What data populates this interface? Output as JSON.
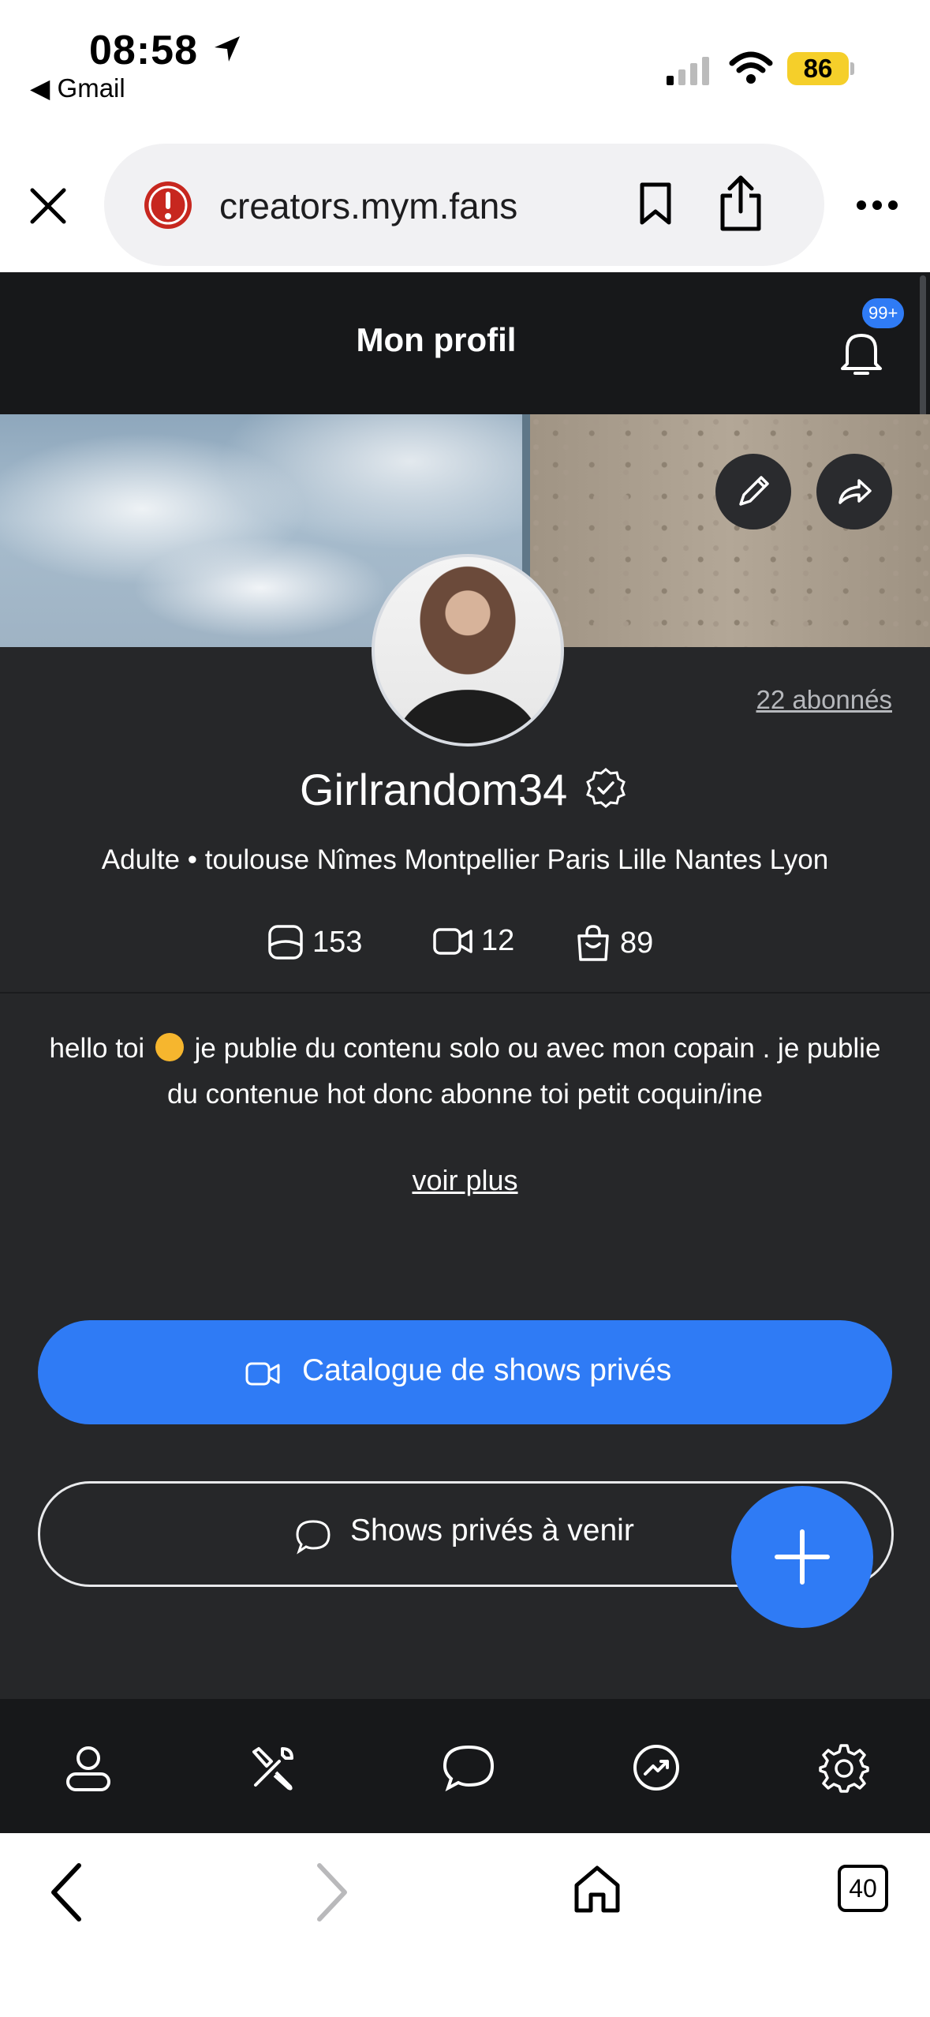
{
  "status_bar": {
    "time": "08:58",
    "back_app": "Gmail",
    "battery": "86"
  },
  "browser": {
    "url": "creators.mym.fans",
    "tab_count": "40"
  },
  "header": {
    "title": "Mon profil",
    "notification_badge": "99+"
  },
  "profile": {
    "subscribers": "22 abonnés",
    "username": "Girlrandom34",
    "tagline": "Adulte • toulouse Nîmes Montpellier Paris Lille Nantes Lyon",
    "stats": {
      "photos": "153",
      "videos": "12",
      "purchases": "89"
    },
    "bio_part1": "hello toi",
    "bio_part2": "je publie du contenu solo ou avec mon copain . je publie du contenue hot donc abonne toi petit coquin/ine",
    "see_more": "voir plus"
  },
  "buttons": {
    "catalog": "Catalogue de shows privés",
    "upcoming": "Shows privés à venir"
  },
  "colors": {
    "accent": "#2f7bf5",
    "background": "#262729",
    "header": "#17181a"
  },
  "icons": {
    "bottom_nav": [
      "profile-icon",
      "tools-icon",
      "chat-icon",
      "stats-icon",
      "settings-icon"
    ]
  }
}
